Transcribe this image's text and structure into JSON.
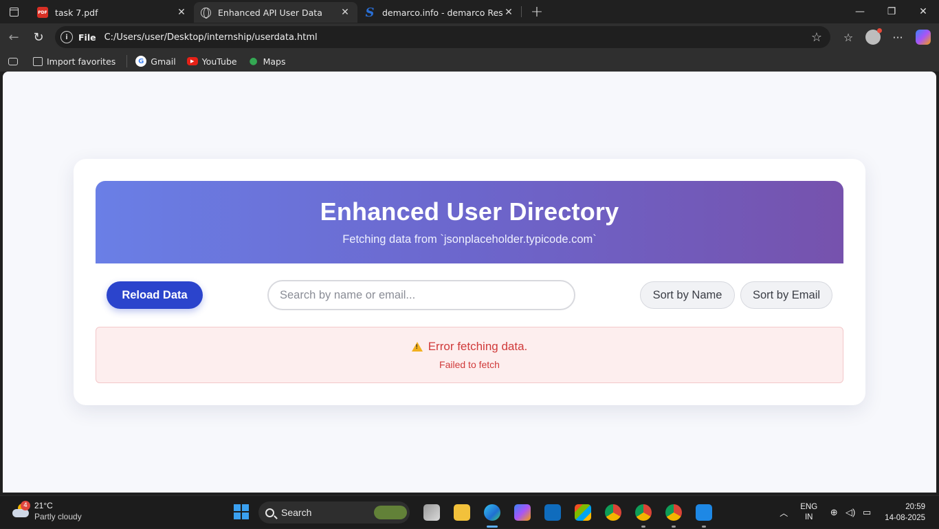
{
  "browser": {
    "tabs": [
      {
        "label": "task 7.pdf",
        "icon": "pdf-icon"
      },
      {
        "label": "Enhanced API User Data",
        "icon": "globe-icon"
      },
      {
        "label": "demarco.info - demarco Resources",
        "icon": "site-s-icon"
      }
    ],
    "address": {
      "protocol": "File",
      "url": "C:/Users/user/Desktop/internship/userdata.html"
    },
    "favorites": [
      {
        "label": "Import favorites"
      },
      {
        "label": "Gmail"
      },
      {
        "label": "YouTube"
      },
      {
        "label": "Maps"
      }
    ]
  },
  "page": {
    "hero": {
      "title": "Enhanced User Directory",
      "subtitle": "Fetching data from `jsonplaceholder.typicode.com`"
    },
    "controls": {
      "reload_label": "Reload Data",
      "search_placeholder": "Search by name or email...",
      "search_value": "",
      "sort_name_label": "Sort by Name",
      "sort_email_label": "Sort by Email"
    },
    "error": {
      "title": "Error fetching data.",
      "detail": "Failed to fetch"
    },
    "colors": {
      "hero_start": "#6a7fe6",
      "hero_end": "#7652ad",
      "primary_button": "#2b44cc",
      "error_text": "#d03a3a",
      "error_background": "#fdeeee"
    }
  },
  "taskbar": {
    "weather": {
      "temp": "21°C",
      "condition": "Partly cloudy",
      "badge": "4"
    },
    "search_label": "Search",
    "language": {
      "line1": "ENG",
      "line2": "IN"
    },
    "time": "20:59",
    "date": "14-08-2025"
  }
}
